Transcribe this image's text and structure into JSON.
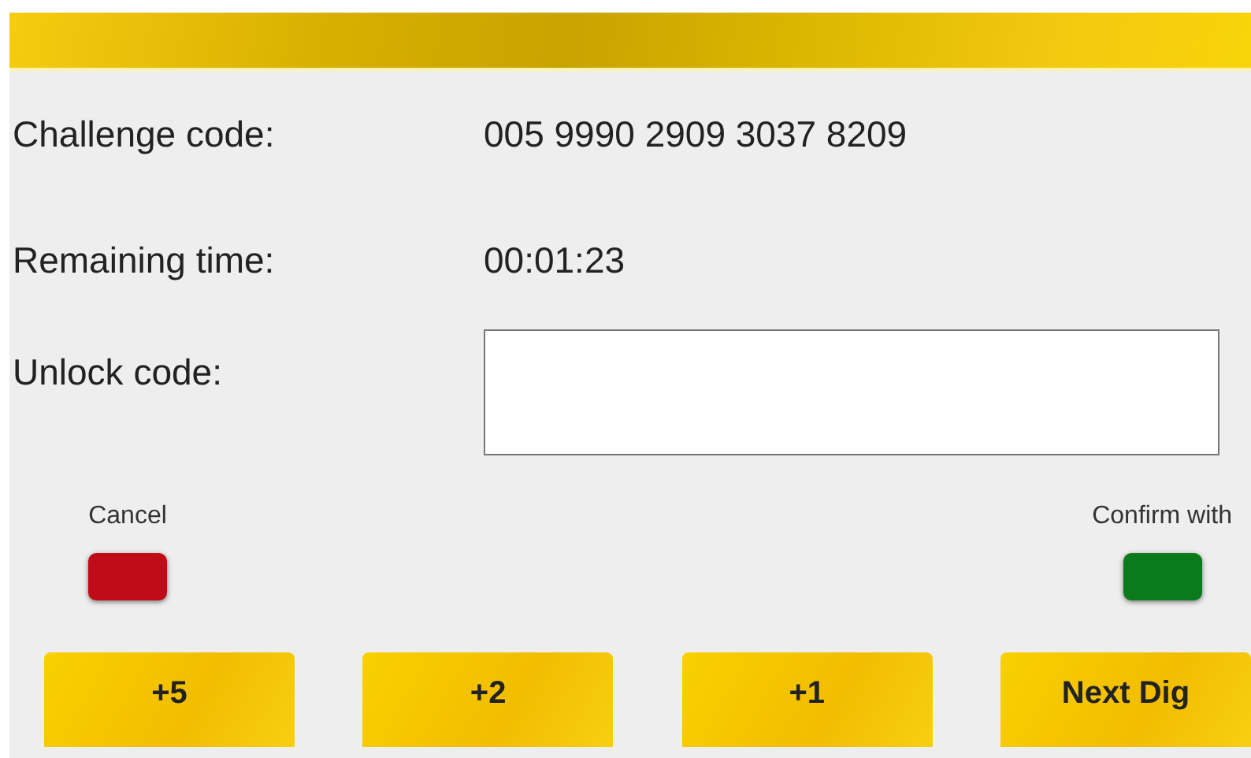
{
  "fields": [
    {
      "label": "Challenge code:",
      "value": "005 9990 2909 3037 8209"
    },
    {
      "label": "Remaining time:",
      "value": "00:01:23"
    }
  ],
  "unlock": {
    "label": "Unlock code:"
  },
  "keys": [
    {
      "label": "Cancel",
      "color": "#c00c18"
    },
    {
      "label": "Confirm with",
      "color": "#0b7a1c"
    }
  ],
  "buttons": [
    {
      "label": "+5"
    },
    {
      "label": "+2"
    },
    {
      "label": "+1"
    },
    {
      "label": "Next Dig"
    }
  ]
}
